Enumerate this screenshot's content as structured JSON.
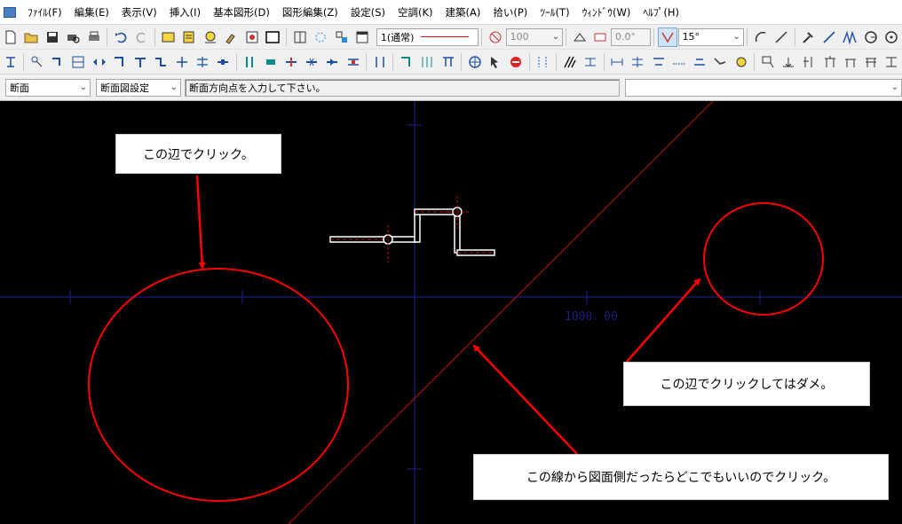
{
  "menu": {
    "items": [
      "ﾌｧｲﾙ(F)",
      "編集(E)",
      "表示(V)",
      "挿入(I)",
      "基本図形(D)",
      "図形編集(Z)",
      "設定(S)",
      "空調(K)",
      "建築(A)",
      "拾い(P)",
      "ﾂｰﾙ(T)",
      "ｳｨﾝﾄﾞｳ(W)",
      "ﾍﾙﾌﾟ(H)"
    ]
  },
  "toolbar1": {
    "layer_value": "1(通常)",
    "scale_value": "100",
    "angle_value": "0.0°",
    "snap_angle_value": "15°"
  },
  "toolbar3": {
    "mode_select": "断面",
    "settings_select": "断面図設定",
    "prompt": "断面方向点を入力して下さい。",
    "right_select": ""
  },
  "canvas": {
    "dimension_label": "1000．00",
    "callouts": {
      "click_here": "この辺でクリック。",
      "dont_click": "この辺でクリックしてはダメ。",
      "line_side": "この線から図面側だったらどこでもいいのでクリック。"
    }
  },
  "colors": {
    "canvas_bg": "#000000",
    "axis": "#1c1c7e",
    "annotation": "#ff0000",
    "pipe": "#ffffff"
  }
}
